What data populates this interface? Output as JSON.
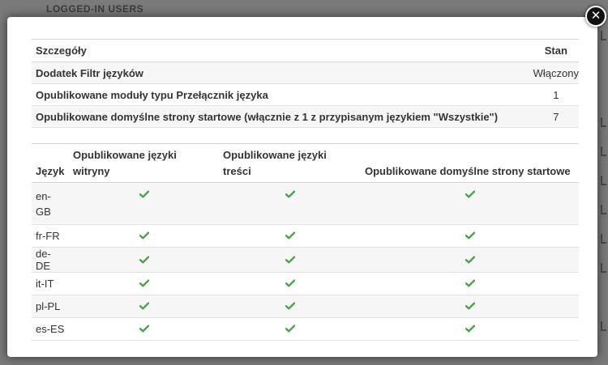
{
  "background": {
    "heading": "LOGGED-IN USERS"
  },
  "close": {
    "glyph": "✕"
  },
  "details": {
    "headers": {
      "details": "Szczegóły",
      "status": "Stan"
    },
    "rows": [
      {
        "label": "Dodatek Filtr języków",
        "value": "Włączony"
      },
      {
        "label": "Opublikowane moduły typu Przełącznik języka",
        "value": "1"
      },
      {
        "label": "Opublikowane domyślne strony startowe (włącznie z 1 z przypisanym językiem \"Wszystkie\")",
        "value": "7"
      }
    ]
  },
  "languages": {
    "headers": {
      "language": "Język",
      "site": "Opublikowane języki witryny",
      "content": "Opublikowane języki treści",
      "home": "Opublikowane domyślne strony startowe"
    },
    "rows": [
      {
        "code": "en-GB",
        "site": true,
        "content": true,
        "home": true
      },
      {
        "code": "fr-FR",
        "site": true,
        "content": true,
        "home": true
      },
      {
        "code": "de-DE",
        "site": true,
        "content": true,
        "home": true
      },
      {
        "code": "it-IT",
        "site": true,
        "content": true,
        "home": true
      },
      {
        "code": "pl-PL",
        "site": true,
        "content": true,
        "home": true
      },
      {
        "code": "es-ES",
        "site": true,
        "content": true,
        "home": true
      }
    ]
  },
  "colors": {
    "check": "#46a546",
    "row_alt": "#f6f6f6"
  },
  "icons": {
    "close": "close-icon",
    "check": "check-icon"
  }
}
